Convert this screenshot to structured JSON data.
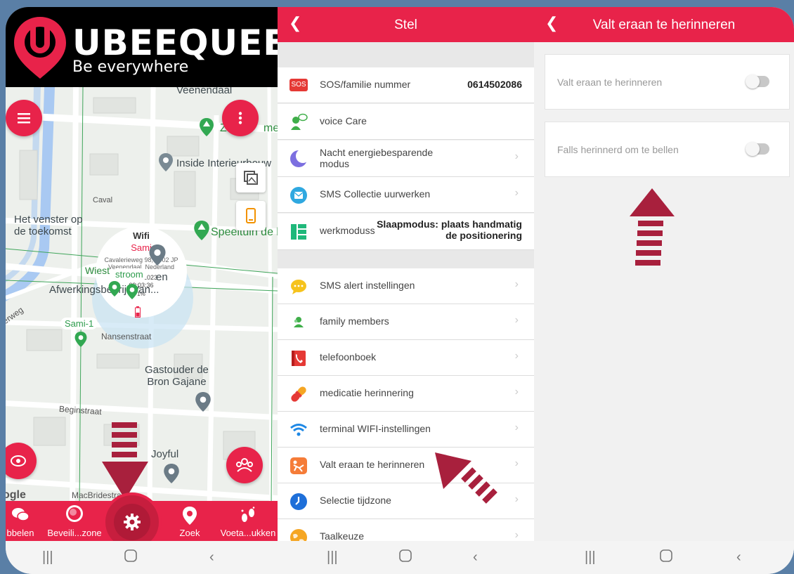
{
  "colors": {
    "accent": "#e8234a",
    "arrow": "#a8203d"
  },
  "panel1": {
    "logo": {
      "title": "UBEEQUEE",
      "subtitle": "Be everywhere"
    },
    "map_labels": {
      "veenendaal": "Veenendaal",
      "zeilmeester": "Z",
      "zeilmeester_tail": "me",
      "inside": "Inside Interieurbouw",
      "venster": "Het venster op\nde toekomst",
      "speeltuin": "Speeltuin de l",
      "wiest": "Wiest",
      "stroom": "stroom",
      "en": "en",
      "afwerking": "Afwerkingsbedrijf Van...",
      "weg": "erweg",
      "sami1": "Sami-1",
      "nansen": "Nansenstraat",
      "gastouder": "Gastouder de\nBron Gajane",
      "begin": "Beginstraat",
      "joyful": "Joyful",
      "macbride": "MacBridestraat",
      "google": "ogle",
      "caval": "Caval"
    },
    "popup": {
      "type": "Wifi",
      "name": "Sami",
      "address": "Cavalerieweg 98, 3902 JP Veenendaal, Nederland",
      "date": "16-04-2023",
      "time": "09:03:36",
      "battery": "1%"
    },
    "nav": [
      {
        "label": "bbelen",
        "icon": "chat-icon"
      },
      {
        "label": "Beveili...zone",
        "icon": "geofence-icon"
      },
      {
        "label": "",
        "icon": "gear-icon"
      },
      {
        "label": "Zoek",
        "icon": "location-pin-icon"
      },
      {
        "label": "Voeta...ukken",
        "icon": "footsteps-icon"
      }
    ]
  },
  "panel2": {
    "title": "Stel",
    "rows": [
      {
        "label": "SOS/familie nummer",
        "value": "0614502086",
        "icon": "sos-icon",
        "sos_text": "SOS"
      },
      {
        "label": "voice Care",
        "value": "",
        "icon": "voice-care-icon"
      },
      {
        "label": "Nacht energiebesparende modus",
        "value": "",
        "icon": "moon-icon"
      },
      {
        "label": "SMS Collectie uurwerken",
        "value": "",
        "icon": "sms-collect-icon"
      },
      {
        "label": "werkmoduss",
        "value": "Slaapmodus: plaats handmatig de positionering",
        "icon": "work-mode-icon"
      },
      {
        "label": "SMS alert instellingen",
        "value": "",
        "icon": "sms-alert-icon"
      },
      {
        "label": "family members",
        "value": "",
        "icon": "family-icon"
      },
      {
        "label": "telefoonboek",
        "value": "",
        "icon": "phonebook-icon"
      },
      {
        "label": "medicatie herinnering",
        "value": "",
        "icon": "medication-icon"
      },
      {
        "label": "terminal WIFI-instellingen",
        "value": "",
        "icon": "wifi-icon"
      },
      {
        "label": "Valt eraan te herinneren",
        "value": "",
        "icon": "fall-icon"
      },
      {
        "label": "Selectie tijdzone",
        "value": "",
        "icon": "clock-icon"
      },
      {
        "label": "Taalkeuze",
        "value": "",
        "icon": "globe-icon"
      }
    ]
  },
  "panel3": {
    "title": "Valt eraan te herinneren",
    "cards": [
      {
        "label": "Valt eraan te herinneren",
        "on": false
      },
      {
        "label": "Falls herinnerd om te bellen",
        "on": false
      }
    ]
  }
}
